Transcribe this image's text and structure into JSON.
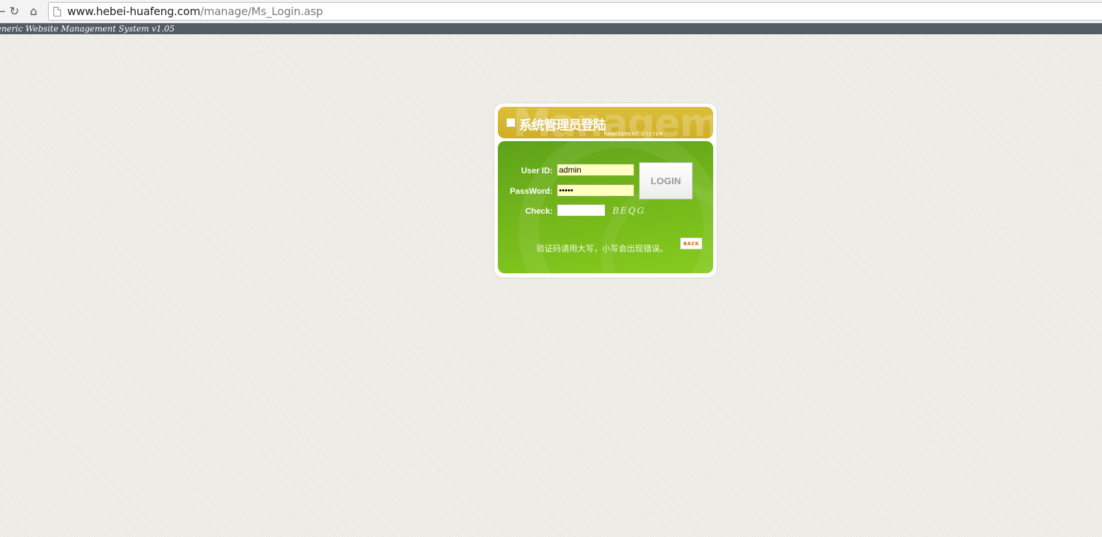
{
  "browser": {
    "back_icon": "back-arrow-icon",
    "reload_icon": "reload-icon",
    "home_icon": "home-icon",
    "url_host": "www.hebei-huafeng.com",
    "url_path": "/manage/Ms_Login.asp"
  },
  "system_bar": {
    "title": "eneric Website Management System v1.05"
  },
  "login": {
    "header_title": "系统管理员登陆",
    "header_subtitle": "MANAGEMENT SYSTEM",
    "header_watermark": "Managem",
    "user_id_label": "User ID:",
    "user_id_value": "admin",
    "password_label": "PassWord:",
    "password_value": "•••••",
    "check_label": "Check:",
    "check_value": "",
    "captcha_text": "BEQG",
    "login_button": "LOGIN",
    "hint_text": "验证码请用大写，小写会出现错误。",
    "back_button": "BACK"
  },
  "colors": {
    "header_gold": "#cfae25",
    "body_green": "#72b51a",
    "field_yellow": "#ffffc2",
    "sysbar": "#535b63"
  }
}
